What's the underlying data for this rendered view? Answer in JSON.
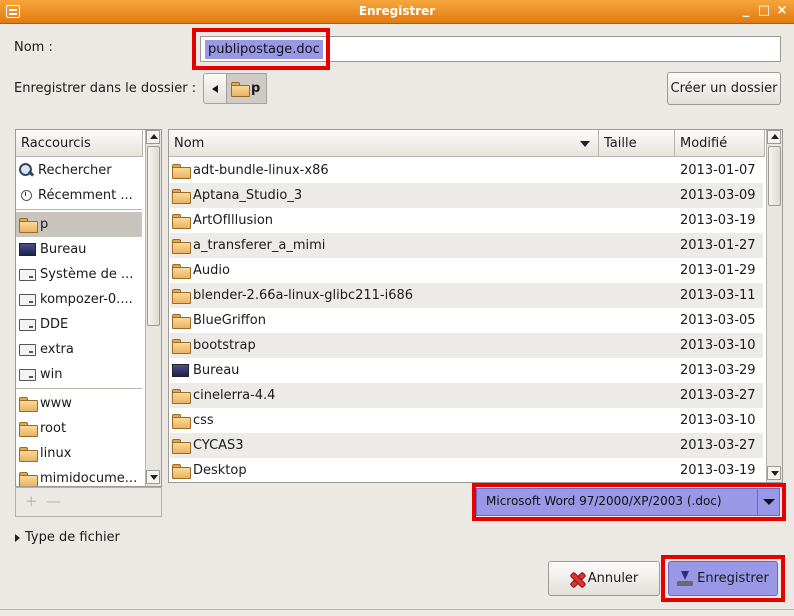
{
  "window": {
    "title": "Enregistrer"
  },
  "name_field": {
    "label": "Nom :",
    "value": "publipostage.doc"
  },
  "folder": {
    "label": "Enregistrer dans le dossier :",
    "current": "p",
    "create_button": "Créer un dossier"
  },
  "shortcuts": {
    "header": "Raccourcis",
    "items": [
      {
        "label": "Rechercher",
        "icon": "search-icon"
      },
      {
        "label": "Récemment ...",
        "icon": "clock-icon"
      },
      {
        "label": "p",
        "icon": "folder-icon",
        "selected": true
      },
      {
        "label": "Bureau",
        "icon": "desktop-icon"
      },
      {
        "label": "Système de ...",
        "icon": "drive-icon"
      },
      {
        "label": "kompozer-0....",
        "icon": "drive-icon"
      },
      {
        "label": "DDE",
        "icon": "drive-icon"
      },
      {
        "label": "extra",
        "icon": "drive-icon"
      },
      {
        "label": "win",
        "icon": "drive-icon"
      },
      {
        "label": "www",
        "icon": "folder-icon"
      },
      {
        "label": "root",
        "icon": "folder-icon"
      },
      {
        "label": "linux",
        "icon": "folder-icon"
      },
      {
        "label": "mimidocume...",
        "icon": "folder-icon"
      }
    ],
    "add_label": "+",
    "remove_label": "—"
  },
  "files": {
    "columns": {
      "name": "Nom",
      "size": "Taille",
      "modified": "Modifié"
    },
    "rows": [
      {
        "name": "adt-bundle-linux-x86",
        "modified": "2013-01-07",
        "icon": "folder-icon"
      },
      {
        "name": "Aptana_Studio_3",
        "modified": "2013-03-09",
        "icon": "folder-icon"
      },
      {
        "name": "ArtOfIllusion",
        "modified": "2013-03-19",
        "icon": "folder-icon"
      },
      {
        "name": "a_transferer_a_mimi",
        "modified": "2013-01-27",
        "icon": "folder-icon"
      },
      {
        "name": "Audio",
        "modified": "2013-01-29",
        "icon": "folder-icon"
      },
      {
        "name": "blender-2.66a-linux-glibc211-i686",
        "modified": "2013-03-11",
        "icon": "folder-icon"
      },
      {
        "name": "BlueGriffon",
        "modified": "2013-03-05",
        "icon": "folder-icon"
      },
      {
        "name": "bootstrap",
        "modified": "2013-03-10",
        "icon": "folder-icon"
      },
      {
        "name": "Bureau",
        "modified": "2013-03-29",
        "icon": "desktop-icon"
      },
      {
        "name": "cinelerra-4.4",
        "modified": "2013-03-27",
        "icon": "folder-icon"
      },
      {
        "name": "css",
        "modified": "2013-03-10",
        "icon": "folder-icon"
      },
      {
        "name": "CYCAS3",
        "modified": "2013-03-27",
        "icon": "folder-icon"
      },
      {
        "name": "Desktop",
        "modified": "2013-03-19",
        "icon": "folder-icon"
      }
    ]
  },
  "filter": {
    "selected": "Microsoft Word 97/2000/XP/2003 (.doc)"
  },
  "file_type_expander": {
    "label": "Type de fichier"
  },
  "buttons": {
    "cancel": "Annuler",
    "save": "Enregistrer"
  },
  "colors": {
    "titlebar": "#e98a1e",
    "selection": "#9a98e6",
    "highlight_box": "#e60000"
  }
}
